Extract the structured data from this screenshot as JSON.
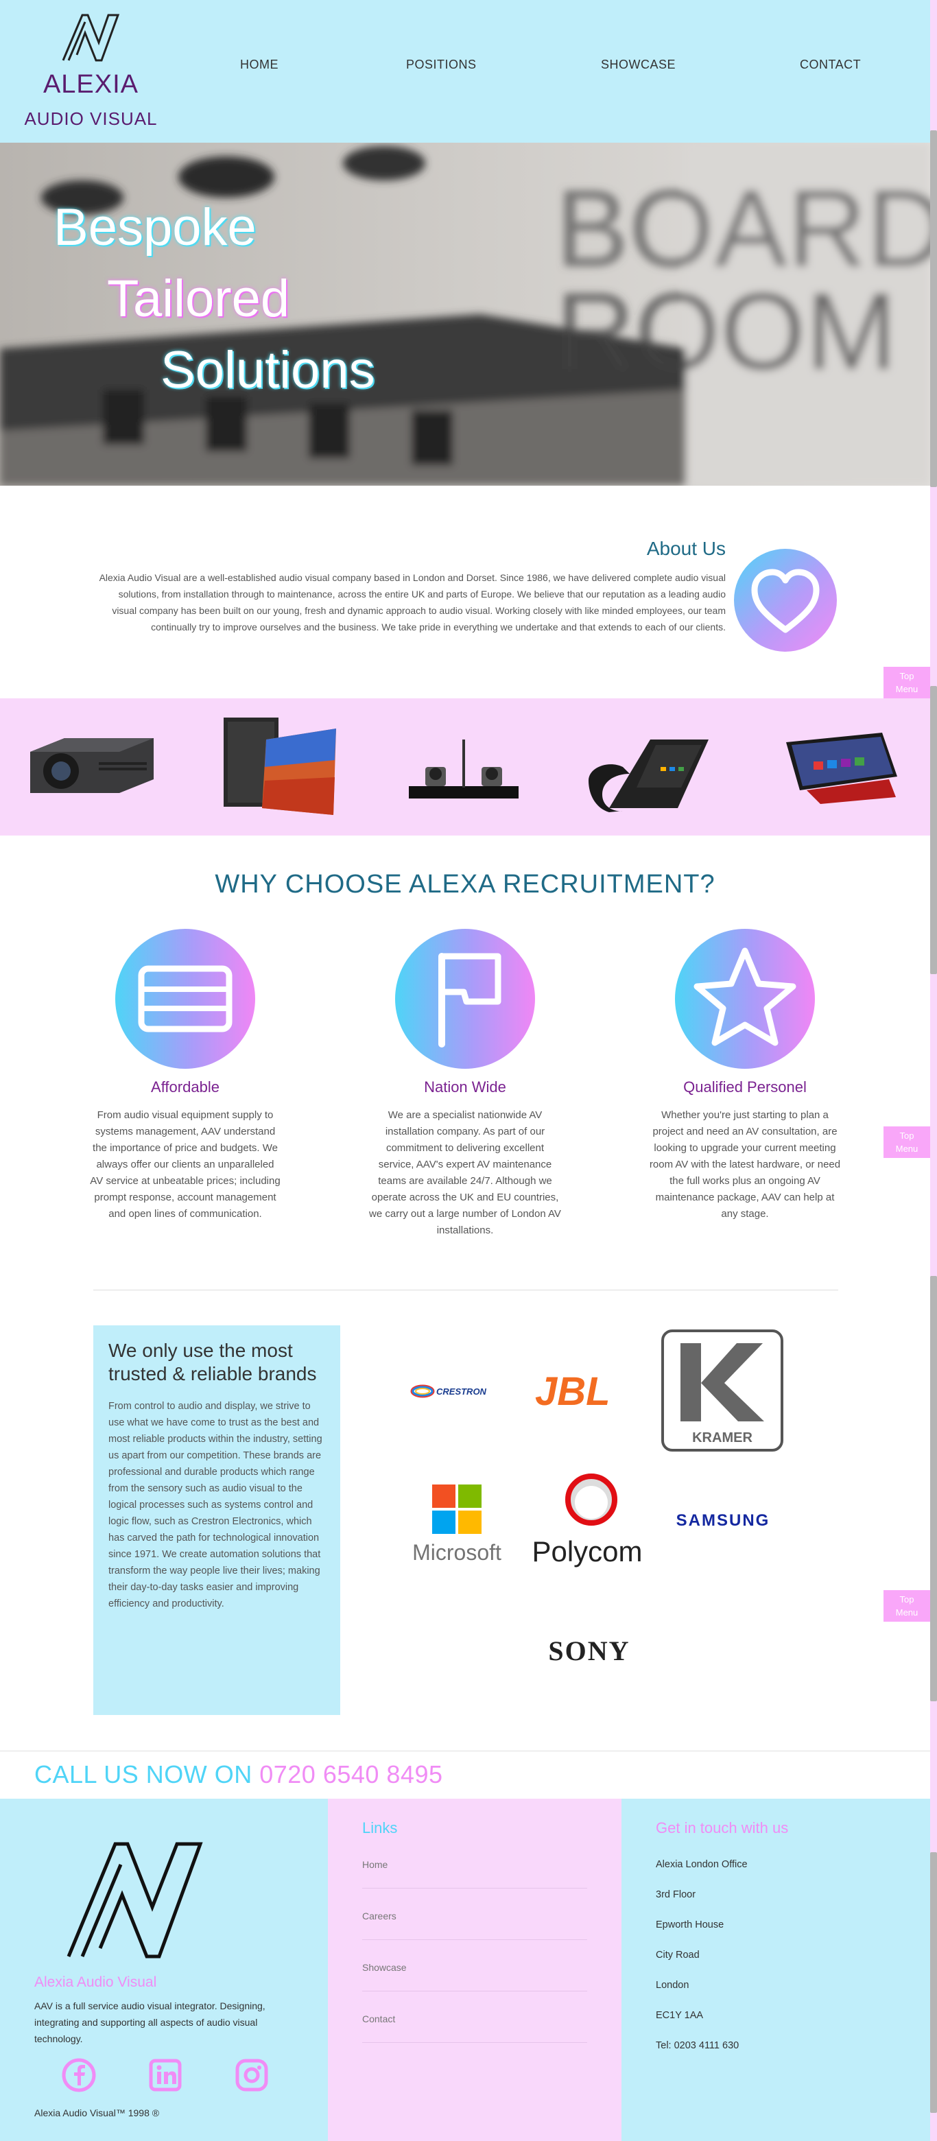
{
  "brand": {
    "name": "ALEXIA",
    "sub": "AUDIO VISUAL"
  },
  "nav": [
    {
      "label": "HOME"
    },
    {
      "label": "POSITIONS"
    },
    {
      "label": "SHOWCASE"
    },
    {
      "label": "CONTACT"
    }
  ],
  "hero": {
    "line1": "Bespoke",
    "line2": "Tailored",
    "line3": "Solutions",
    "sign_text": "BOARD ROOM"
  },
  "about": {
    "title": "About Us",
    "text": "Alexia Audio Visual are a well-established audio visual company based in London and Dorset. Since 1986, we have delivered complete audio visual solutions, from installation through to maintenance, across the entire UK and parts of Europe. We believe that our reputation as a leading audio visual company has been built on our young, fresh and dynamic approach to audio visual. Working closely with like minded employees, our team continually try to improve ourselves and the business. We take pride in everything we undertake and that extends to each of our clients."
  },
  "top_menu": {
    "line1": "Top",
    "line2": "Menu"
  },
  "why": {
    "title": "WHY CHOOSE ALEXA RECRUITMENT?",
    "features": [
      {
        "icon": "card-icon",
        "title": "Affordable",
        "text": "From audio visual equipment supply to systems management, AAV understand the importance of price and budgets. We always offer our clients an unparalleled AV service at unbeatable prices; including prompt response, account management and open lines of communication."
      },
      {
        "icon": "flag-icon",
        "title": "Nation Wide",
        "text": "We are a specialist nationwide AV installation company. As part of our commitment to delivering excellent service, AAV's expert AV maintenance teams are available 24/7. Although we operate across the UK and EU countries, we carry out a large number of London AV installations."
      },
      {
        "icon": "star-icon",
        "title": "Qualified Personel",
        "text": "Whether you're just starting to plan a project and need an AV consultation, are looking to upgrade your current meeting room AV with the latest hardware, or need the full works plus an ongoing AV maintenance package, AAV can help at any stage."
      }
    ]
  },
  "brands": {
    "title": "We only use the most trusted & reliable brands",
    "text": "From control to audio and display, we strive to use what we have come to trust as the best and most reliable products within the industry, setting us apart from our competition. These brands are professional and durable products which range from the sensory such as audio visual to the logical processes such as systems control and logic flow, such as Crestron Electronics, which has carved the path for technological innovation since 1971. We create automation solutions that transform the way people live their lives; making their day-to-day tasks easier and improving efficiency and productivity.",
    "logos": {
      "crestron": "CRESTRON",
      "jbl": "JBL",
      "kramer": "KRAMER",
      "microsoft": "Microsoft",
      "polycom": "Polycom",
      "samsung": "SAMSUNG",
      "sony": "SONY"
    }
  },
  "call": {
    "text": "CALL US NOW ON",
    "number": "0720 6540 8495"
  },
  "footer": {
    "brand": "Alexia Audio Visual",
    "desc": "AAV is a full service audio visual integrator. Designing, integrating and supporting all aspects of audio visual technology.",
    "copyright": "Alexia Audio Visual™ 1998 ®",
    "links_title": "Links",
    "links": [
      "Home",
      "Careers",
      "Showcase",
      "Contact"
    ],
    "contact_title": "Get in touch with us",
    "address": [
      "Alexia London Office",
      "3rd Floor",
      "Epworth House",
      "City Road",
      "London",
      "EC1Y 1AA",
      "Tel: 0203 4111 630"
    ]
  },
  "colors": {
    "header_bg": "#c0eefa",
    "pink_bg": "#f9d8fb",
    "accent_cyan": "#4fd4f7",
    "accent_pink": "#f08cf5",
    "purple": "#7a2290",
    "teal": "#1f6a86"
  }
}
